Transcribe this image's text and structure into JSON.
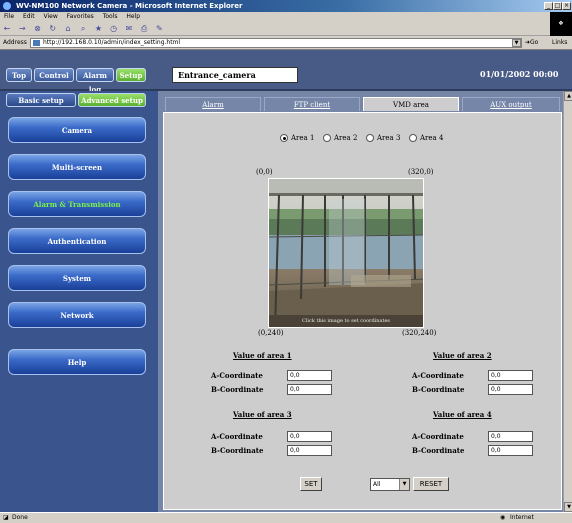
{
  "window": {
    "title": "WV-NM100 Network Camera - Microsoft Internet Explorer"
  },
  "menu": [
    "File",
    "Edit",
    "View",
    "Favorites",
    "Tools",
    "Help"
  ],
  "address": {
    "label": "Address",
    "url": "http://192.168.0.10/admin/index_setting.html",
    "go": "Go",
    "links": "Links"
  },
  "top_tabs": [
    "Top",
    "Control",
    "Alarm log",
    "Setup"
  ],
  "camera_title": "Entrance_camera",
  "datetime": "01/01/2002  00:00",
  "sub_tabs": [
    "Basic setup",
    "Advanced setup"
  ],
  "nav": [
    "Camera",
    "Multi-screen",
    "Alarm & Transmission",
    "Authentication",
    "System",
    "Network",
    "Help"
  ],
  "form_tabs": [
    "Alarm",
    "FTP client",
    "VMD area",
    "AUX output"
  ],
  "areas": [
    "Area 1",
    "Area 2",
    "Area 3",
    "Area 4"
  ],
  "selected_area": "Area 1",
  "corners": {
    "top_left": "(0,0)",
    "top_right": "(320,0)",
    "bottom_left": "(0,240)",
    "bottom_right": "(320,240)"
  },
  "image_caption": "Click this image to set coordinates",
  "value_blocks": [
    {
      "title": "Value of area 1",
      "a_label": "A-Coordinate",
      "a_value": "0,0",
      "b_label": "B-Coordinate",
      "b_value": "0,0"
    },
    {
      "title": "Value of area 2",
      "a_label": "A-Coordinate",
      "a_value": "0,0",
      "b_label": "B-Coordinate",
      "b_value": "0,0"
    },
    {
      "title": "Value of area 3",
      "a_label": "A-Coordinate",
      "a_value": "0,0",
      "b_label": "B-Coordinate",
      "b_value": "0,0"
    },
    {
      "title": "Value of area 4",
      "a_label": "A-Coordinate",
      "a_value": "0,0",
      "b_label": "B-Coordinate",
      "b_value": "0,0"
    }
  ],
  "buttons": {
    "set": "SET",
    "reset": "RESET",
    "reset_select": "All"
  },
  "status": {
    "left": "Done",
    "right": "Internet"
  },
  "colors": {
    "active_green": "#7cf04a",
    "panel_blue": "#3a558e",
    "form_gray": "#cdcdcd"
  }
}
